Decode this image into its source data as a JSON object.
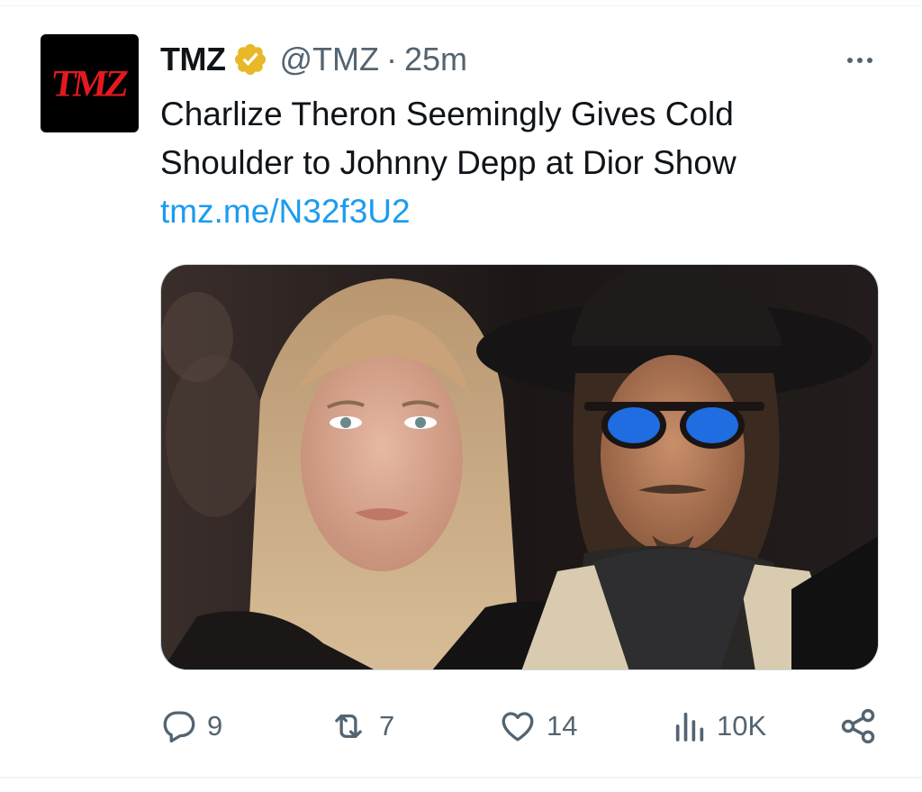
{
  "tweet": {
    "display_name": "TMZ",
    "handle": "@TMZ",
    "separator": "·",
    "time": "25m",
    "avatar_text": "TMZ",
    "text_line1": "Charlize Theron Seemingly Gives Cold",
    "text_line2": "Shoulder to Johnny Depp at Dior Show",
    "link": "tmz.me/N32f3U2",
    "media_icon": "photo-charlize-theron-johnny-depp"
  },
  "actions": {
    "replies": "9",
    "retweets": "7",
    "likes": "14",
    "views": "10K"
  },
  "icons": [
    "verified-badge-icon",
    "more-icon",
    "reply-icon",
    "retweet-icon",
    "like-icon",
    "views-icon",
    "share-icon"
  ],
  "colors": {
    "link": "#1d9bf0",
    "secondary": "#536471",
    "verified": "#e8b829",
    "brand_red": "#e3191f"
  }
}
